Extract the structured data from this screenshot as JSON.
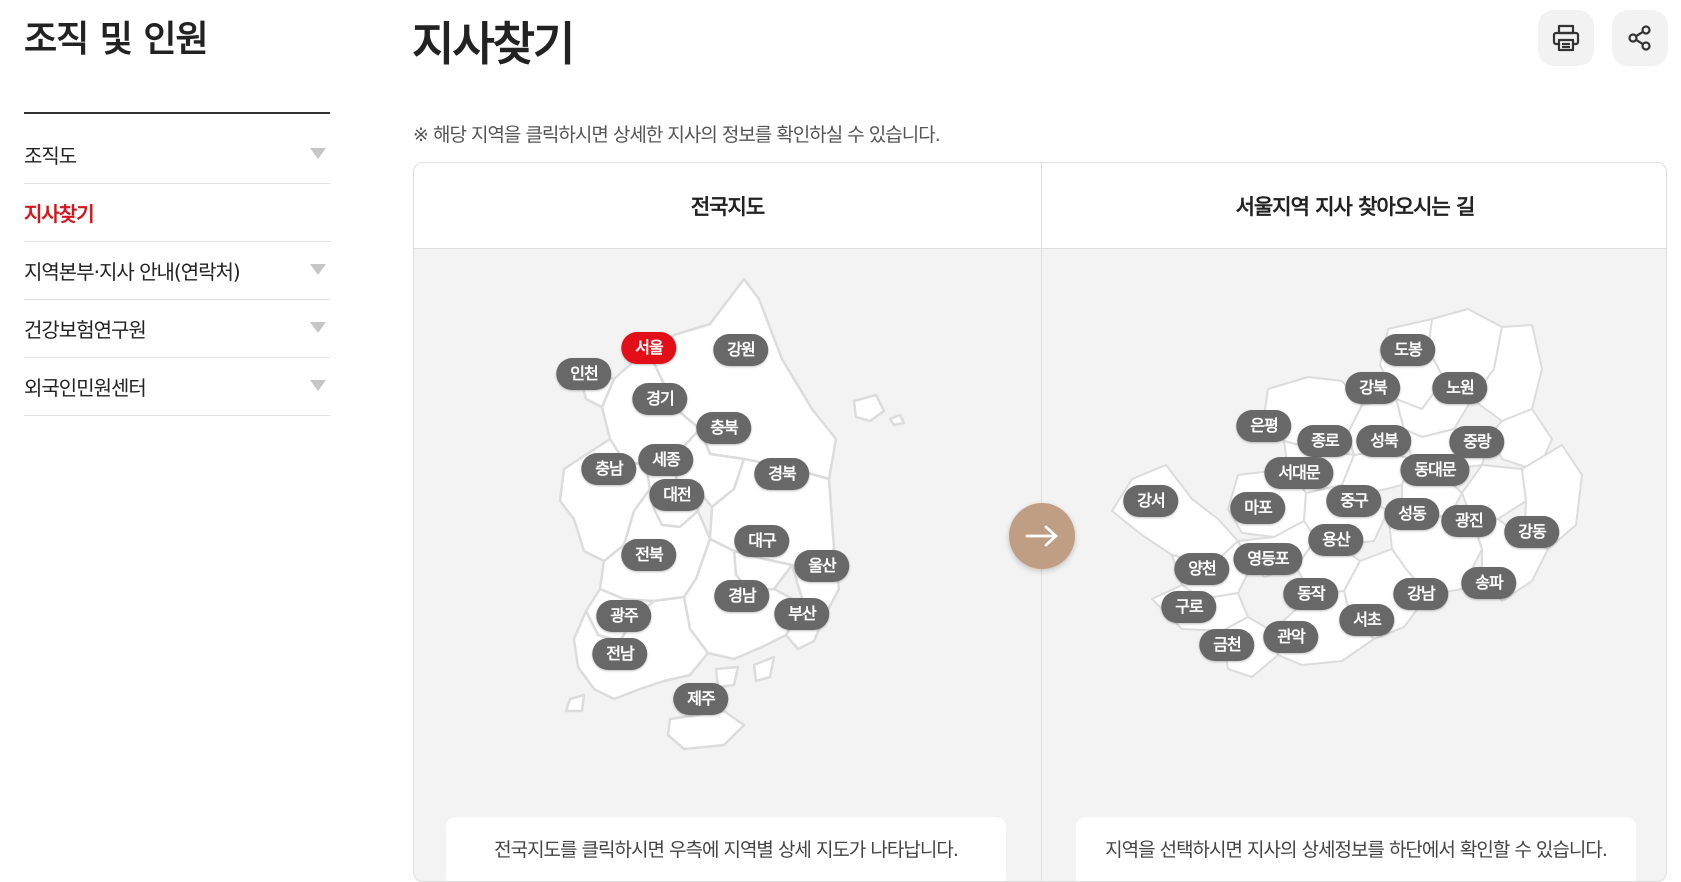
{
  "sidebar": {
    "title": "조직 및 인원",
    "items": [
      {
        "label": "조직도",
        "active": false,
        "expandable": true
      },
      {
        "label": "지사찾기",
        "active": true,
        "expandable": false
      },
      {
        "label": "지역본부·지사 안내(연락처)",
        "active": false,
        "expandable": true
      },
      {
        "label": "건강보험연구원",
        "active": false,
        "expandable": true
      },
      {
        "label": "외국인민원센터",
        "active": false,
        "expandable": true
      }
    ]
  },
  "header": {
    "title": "지사찾기",
    "print_icon": "printer-icon",
    "share_icon": "share-icon"
  },
  "notice": "※ 해당 지역을 클릭하시면 상세한 지사의 정보를 확인하실 수 있습니다.",
  "panels": {
    "national": {
      "title": "전국지도",
      "caption": "전국지도를 클릭하시면 우측에 지역별 상세 지도가 나타납니다.",
      "selected": "서울",
      "regions": [
        "서울",
        "강원",
        "인천",
        "경기",
        "충북",
        "세종",
        "충남",
        "경북",
        "대전",
        "대구",
        "전북",
        "울산",
        "경남",
        "광주",
        "부산",
        "전남",
        "제주"
      ]
    },
    "seoul": {
      "title": "서울지역 지사 찾아오시는 길",
      "caption": "지역을 선택하시면 지사의 상세정보를 하단에서 확인할 수 있습니다.",
      "districts": [
        "도봉",
        "강북",
        "노원",
        "은평",
        "종로",
        "성북",
        "중랑",
        "서대문",
        "동대문",
        "강서",
        "마포",
        "중구",
        "성동",
        "광진",
        "강동",
        "용산",
        "양천",
        "영등포",
        "동작",
        "강남",
        "송파",
        "구로",
        "서초",
        "금천",
        "관악"
      ]
    }
  },
  "arrow_icon": "arrow-right-icon",
  "colors": {
    "accent": "#d7141a",
    "selected_label": "#e30f18",
    "label_bg": "#686868",
    "arrow_bg": "#c09e84",
    "panel_bg": "#f3f3f3"
  }
}
